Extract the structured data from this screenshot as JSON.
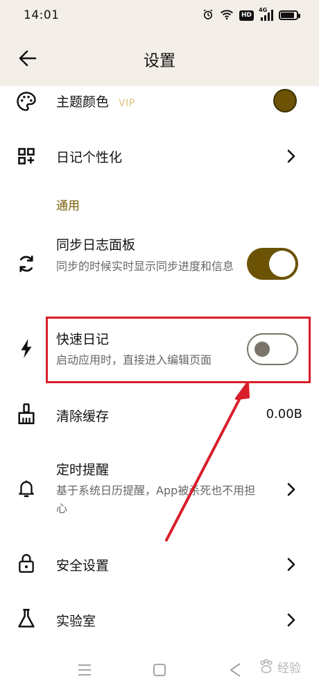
{
  "statusbar": {
    "time": "14:01",
    "hd_badge": "HD",
    "network_badge": "4G",
    "battery_level": 0.85
  },
  "appbar": {
    "title": "设置"
  },
  "settings": {
    "theme_color": {
      "label": "主题颜色",
      "badge": "VIP",
      "color": "#6b5205"
    },
    "diary_personalize": {
      "label": "日记个性化"
    },
    "section_general": "通用",
    "sync_panel": {
      "label": "同步日志面板",
      "description": "同步的时候实时显示同步进度和信息",
      "enabled": true
    },
    "quick_diary": {
      "label": "快速日记",
      "description": "启动应用时，直接进入编辑页面",
      "enabled": false
    },
    "clear_cache": {
      "label": "清除缓存",
      "value": "0.00B"
    },
    "reminder": {
      "label": "定时提醒",
      "description": "基于系统日历提醒，App被杀死也不用担心"
    },
    "security": {
      "label": "安全设置"
    },
    "lab": {
      "label": "实验室"
    }
  },
  "watermark": {
    "text": "经验"
  },
  "colors": {
    "accent": "#6b5205",
    "highlight": "#d91e2a",
    "header_bg": "#f3efe8"
  }
}
